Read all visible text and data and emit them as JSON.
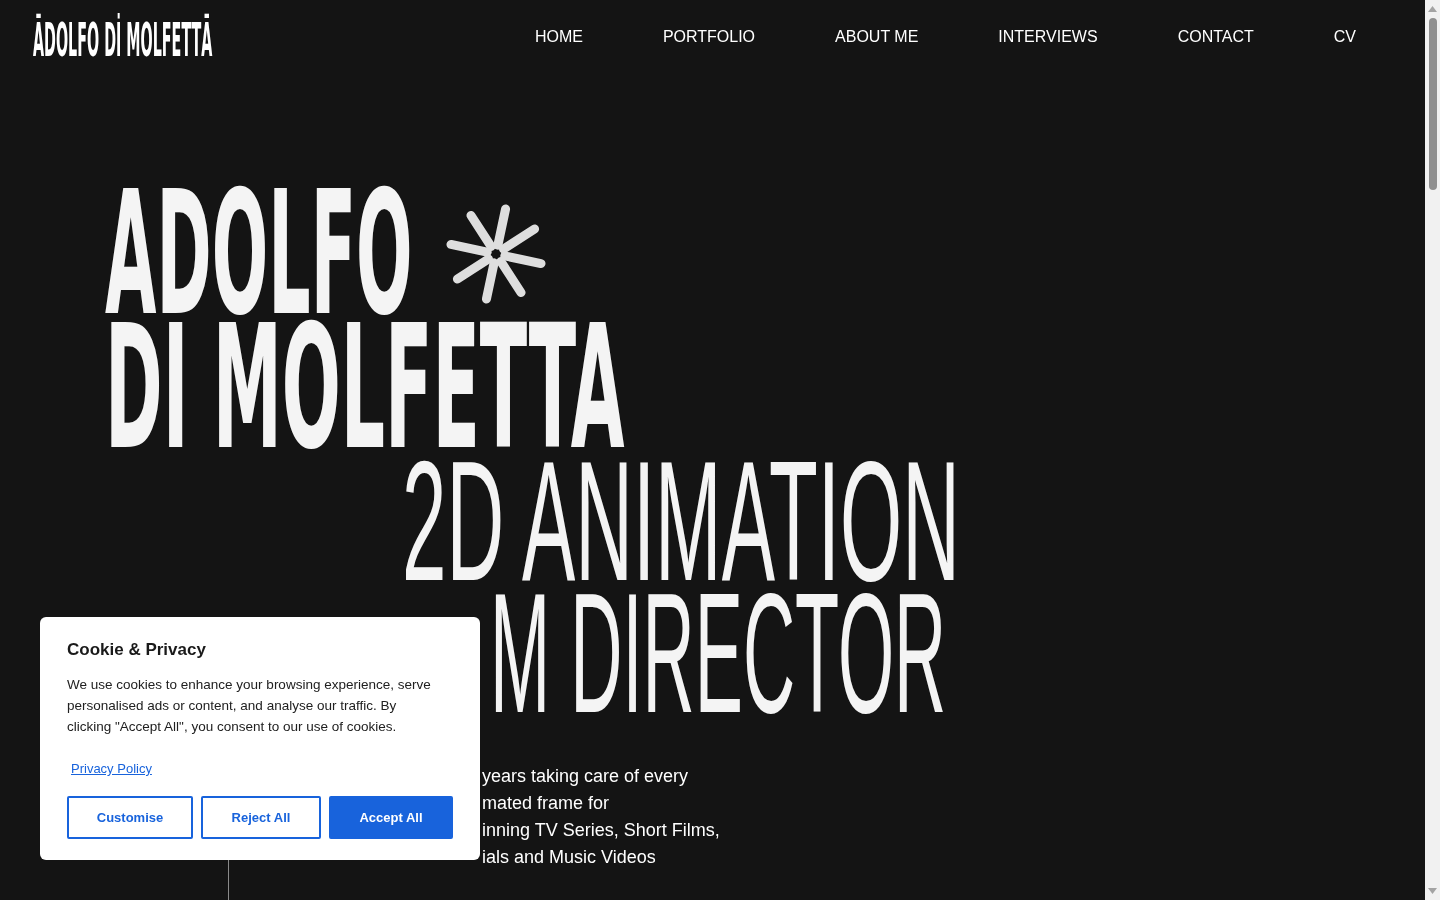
{
  "header": {
    "logo": "ĀDOLFO Dİ MOLFETTĀ",
    "nav": [
      "HOME",
      "PORTFOLIO",
      "ABOUT ME",
      "INTERVIEWS",
      "CONTACT",
      "CV"
    ]
  },
  "hero": {
    "title_lines": [
      "ADOLFO",
      "DI MOLFETTA"
    ],
    "subtitle_lines": [
      "2D ANIMATION",
      "M DIRECTOR"
    ],
    "intro_lines": [
      "years taking care of every",
      "mated frame for",
      "inning TV Series, Short Films,",
      "ials and Music Videos"
    ]
  },
  "cookie_dialog": {
    "title": "Cookie & Privacy",
    "body": "We use cookies to enhance your browsing experience, serve personalised ads or content, and analyse our traffic. By clicking \"Accept All\", you consent to our use of cookies.",
    "link": "Privacy Policy",
    "buttons": [
      {
        "label": "Customise",
        "kind": "outline"
      },
      {
        "label": "Reject All",
        "kind": "outline"
      },
      {
        "label": "Accept All",
        "kind": "primary"
      }
    ]
  }
}
